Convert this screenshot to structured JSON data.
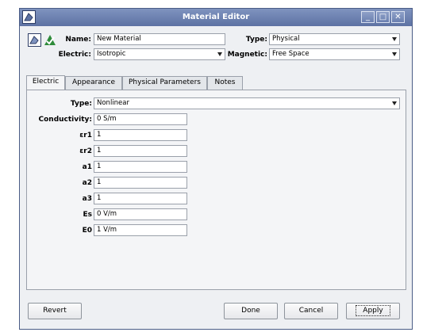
{
  "window": {
    "title": "Material Editor",
    "minimize": "_",
    "maximize": "□",
    "close": "✕"
  },
  "header": {
    "name_label": "Name:",
    "name_value": "New Material",
    "type_label": "Type:",
    "type_value": "Physical",
    "electric_label": "Electric:",
    "electric_value": "Isotropic",
    "magnetic_label": "Magnetic:",
    "magnetic_value": "Free Space"
  },
  "tabs": [
    {
      "label": "Electric"
    },
    {
      "label": "Appearance"
    },
    {
      "label": "Physical Parameters"
    },
    {
      "label": "Notes"
    }
  ],
  "electric_panel": {
    "type_label": "Type:",
    "type_value": "Nonlinear",
    "fields": [
      {
        "label": "Conductivity:",
        "value": "0 S/m"
      },
      {
        "label": "εr1",
        "value": "1"
      },
      {
        "label": "εr2",
        "value": "1"
      },
      {
        "label": "a1",
        "value": "1"
      },
      {
        "label": "a2",
        "value": "1"
      },
      {
        "label": "a3",
        "value": "1"
      },
      {
        "label": "Es",
        "value": "0 V/m"
      },
      {
        "label": "E0",
        "value": "1 V/m"
      }
    ]
  },
  "buttons": {
    "revert": "Revert",
    "done": "Done",
    "cancel": "Cancel",
    "apply": "Apply"
  },
  "colors": {
    "titlebar": "#6a7fb0",
    "accent_green": "#3a9a3a"
  }
}
